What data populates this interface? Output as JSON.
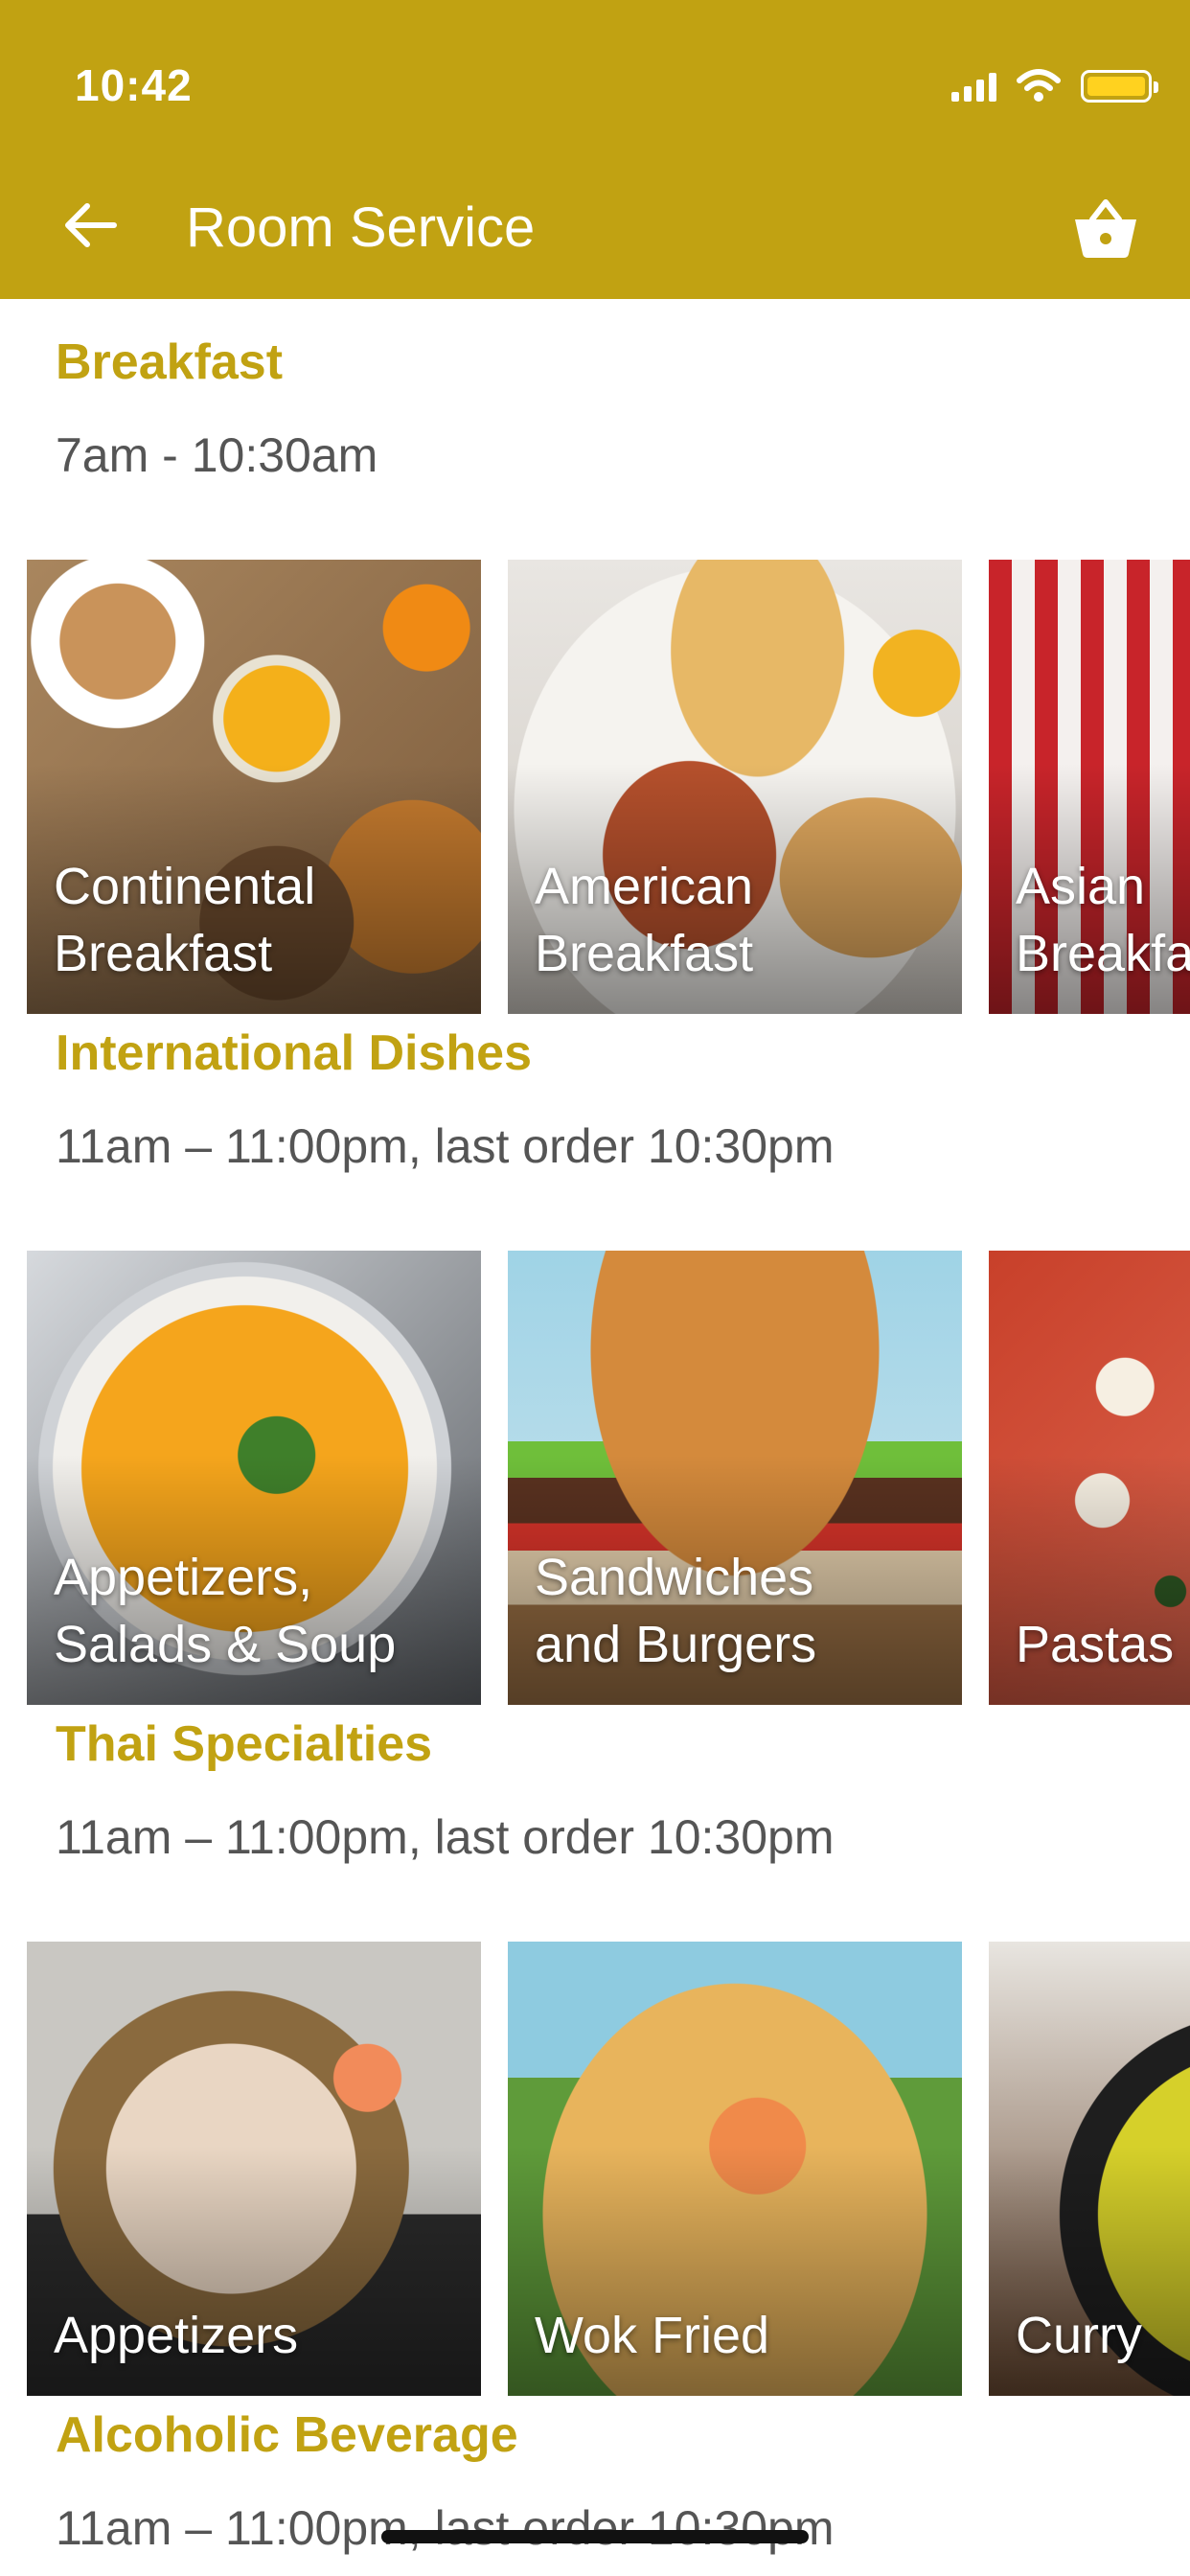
{
  "status_bar": {
    "time": "10:42"
  },
  "header": {
    "title": "Room Service",
    "back_icon": "arrow-left-icon",
    "cart_icon": "basket-icon"
  },
  "sections": [
    {
      "title": "Breakfast",
      "hours": "7am - 10:30am",
      "items": [
        {
          "label": "Continental\nBreakfast"
        },
        {
          "label": "American\nBreakfast"
        },
        {
          "label": "Asian\nBreakfast"
        }
      ]
    },
    {
      "title": "International Dishes",
      "hours": "11am – 11:00pm, last order 10:30pm",
      "items": [
        {
          "label": "Appetizers,\nSalads & Soup"
        },
        {
          "label": "Sandwiches\nand Burgers"
        },
        {
          "label": "Pastas"
        }
      ]
    },
    {
      "title": "Thai Specialties",
      "hours": "11am – 11:00pm, last order 10:30pm",
      "items": [
        {
          "label": "Appetizers"
        },
        {
          "label": "Wok Fried"
        },
        {
          "label": "Curry"
        }
      ]
    },
    {
      "title": "Alcoholic Beverage",
      "hours": "11am – 11:00pm, last order 10:30pm",
      "items": []
    }
  ],
  "colors": {
    "accent": "#C1A212",
    "battery": "#FFD21F"
  }
}
